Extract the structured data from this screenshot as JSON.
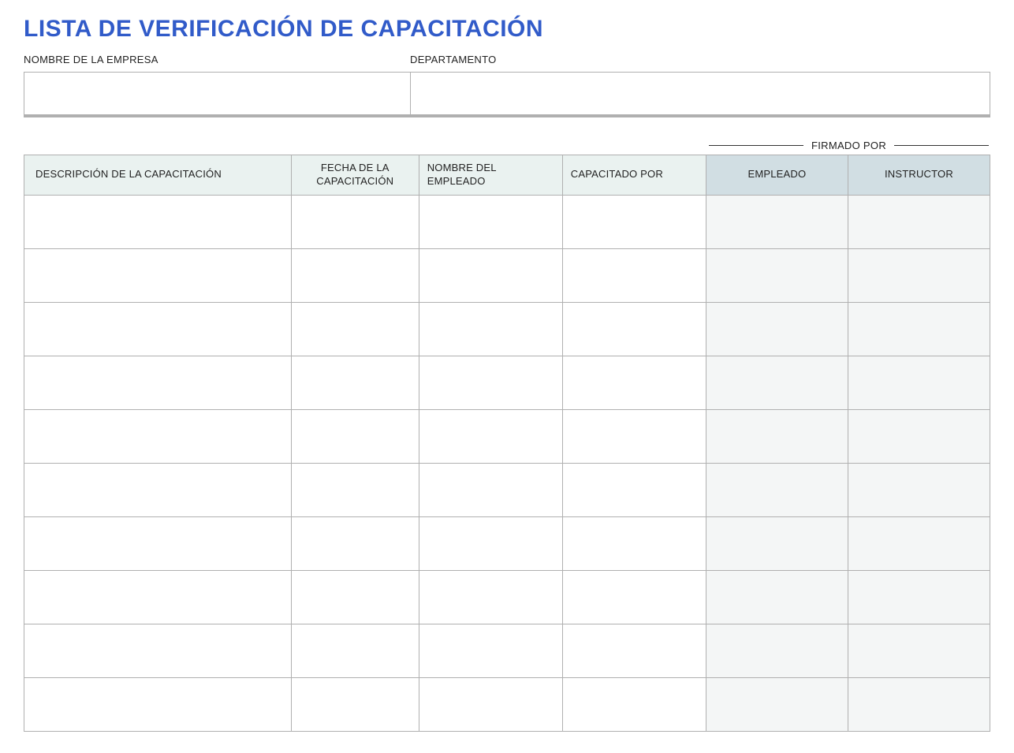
{
  "title": "LISTA DE VERIFICACIÓN DE CAPACITACIÓN",
  "info": {
    "company_label": "NOMBRE DE LA EMPRESA",
    "department_label": "DEPARTAMENTO",
    "company_value": "",
    "department_value": ""
  },
  "signed_by_label": "FIRMADO POR",
  "table": {
    "headers": {
      "description": "DESCRIPCIÓN DE LA CAPACITACIÓN",
      "date": "FECHA DE LA CAPACITACIÓN",
      "employee_name": "NOMBRE DEL EMPLEADO",
      "trained_by": "CAPACITADO POR",
      "employee_sign": "EMPLEADO",
      "instructor_sign": "INSTRUCTOR"
    },
    "rows": [
      {
        "description": "",
        "date": "",
        "employee_name": "",
        "trained_by": "",
        "employee_sign": "",
        "instructor_sign": ""
      },
      {
        "description": "",
        "date": "",
        "employee_name": "",
        "trained_by": "",
        "employee_sign": "",
        "instructor_sign": ""
      },
      {
        "description": "",
        "date": "",
        "employee_name": "",
        "trained_by": "",
        "employee_sign": "",
        "instructor_sign": ""
      },
      {
        "description": "",
        "date": "",
        "employee_name": "",
        "trained_by": "",
        "employee_sign": "",
        "instructor_sign": ""
      },
      {
        "description": "",
        "date": "",
        "employee_name": "",
        "trained_by": "",
        "employee_sign": "",
        "instructor_sign": ""
      },
      {
        "description": "",
        "date": "",
        "employee_name": "",
        "trained_by": "",
        "employee_sign": "",
        "instructor_sign": ""
      },
      {
        "description": "",
        "date": "",
        "employee_name": "",
        "trained_by": "",
        "employee_sign": "",
        "instructor_sign": ""
      },
      {
        "description": "",
        "date": "",
        "employee_name": "",
        "trained_by": "",
        "employee_sign": "",
        "instructor_sign": ""
      },
      {
        "description": "",
        "date": "",
        "employee_name": "",
        "trained_by": "",
        "employee_sign": "",
        "instructor_sign": ""
      },
      {
        "description": "",
        "date": "",
        "employee_name": "",
        "trained_by": "",
        "employee_sign": "",
        "instructor_sign": ""
      }
    ]
  }
}
